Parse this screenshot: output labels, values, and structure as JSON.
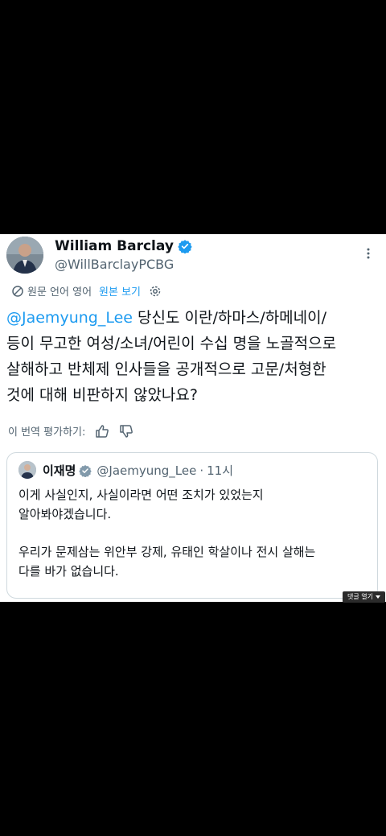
{
  "tweet": {
    "display_name": "William Barclay",
    "handle": "@WillBarclayPCBG",
    "translation_note": "원문 언어 영어",
    "view_original": "원본 보기",
    "mention": "@Jaemyung_Lee",
    "body_line1_rest": " 당신도 이란/하마스/하메네이/",
    "body_line2": "등이 무고한 여성/소녀/어린이 수십 명을 노골적으로",
    "body_line3": "살해하고 반체제 인사들을 공개적으로 고문/처형한",
    "body_line4": "것에 대해 비판하지 않았나요?",
    "rate_translation": "이 번역 평가하기:"
  },
  "quote": {
    "name": "이재명",
    "handle": "@Jaemyung_Lee",
    "dot": "·",
    "time": "11시",
    "paragraph1": "이게 사실인지, 사실이라면 어떤 조치가 있었는지\n알아봐야겠습니다.",
    "paragraph2": "우리가 문제삼는 위안부 강제, 유태인 학살이나 전시 살해는\n다를 바가 없습니다."
  },
  "overlay": {
    "reply_button": "댓글 열기"
  },
  "colors": {
    "link": "#1d9bf0",
    "verified": "#1d9bf0",
    "secondary_text": "#536471"
  },
  "icons": [
    "verified-badge-icon",
    "more-icon",
    "translate-icon",
    "settings-icon",
    "thumbs-up-icon",
    "thumbs-down-icon",
    "caret-down-icon"
  ]
}
